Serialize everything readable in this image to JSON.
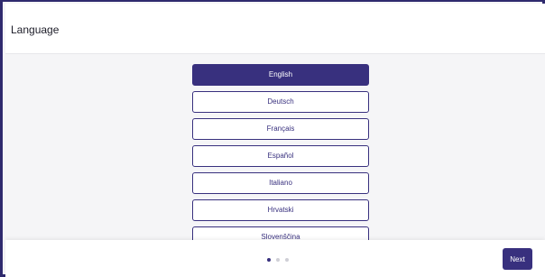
{
  "header": {
    "title": "Language"
  },
  "languages": [
    {
      "label": "English",
      "selected": true
    },
    {
      "label": "Deutsch",
      "selected": false
    },
    {
      "label": "Français",
      "selected": false
    },
    {
      "label": "Español",
      "selected": false
    },
    {
      "label": "Italiano",
      "selected": false
    },
    {
      "label": "Hrvatski",
      "selected": false
    },
    {
      "label": "Slovenščina",
      "selected": false
    }
  ],
  "pagination": {
    "total": 3,
    "current": 1
  },
  "footer": {
    "next_label": "Next"
  },
  "colors": {
    "accent": "#38307e",
    "frame": "#2f2a6e",
    "background": "#f5f5f7"
  }
}
